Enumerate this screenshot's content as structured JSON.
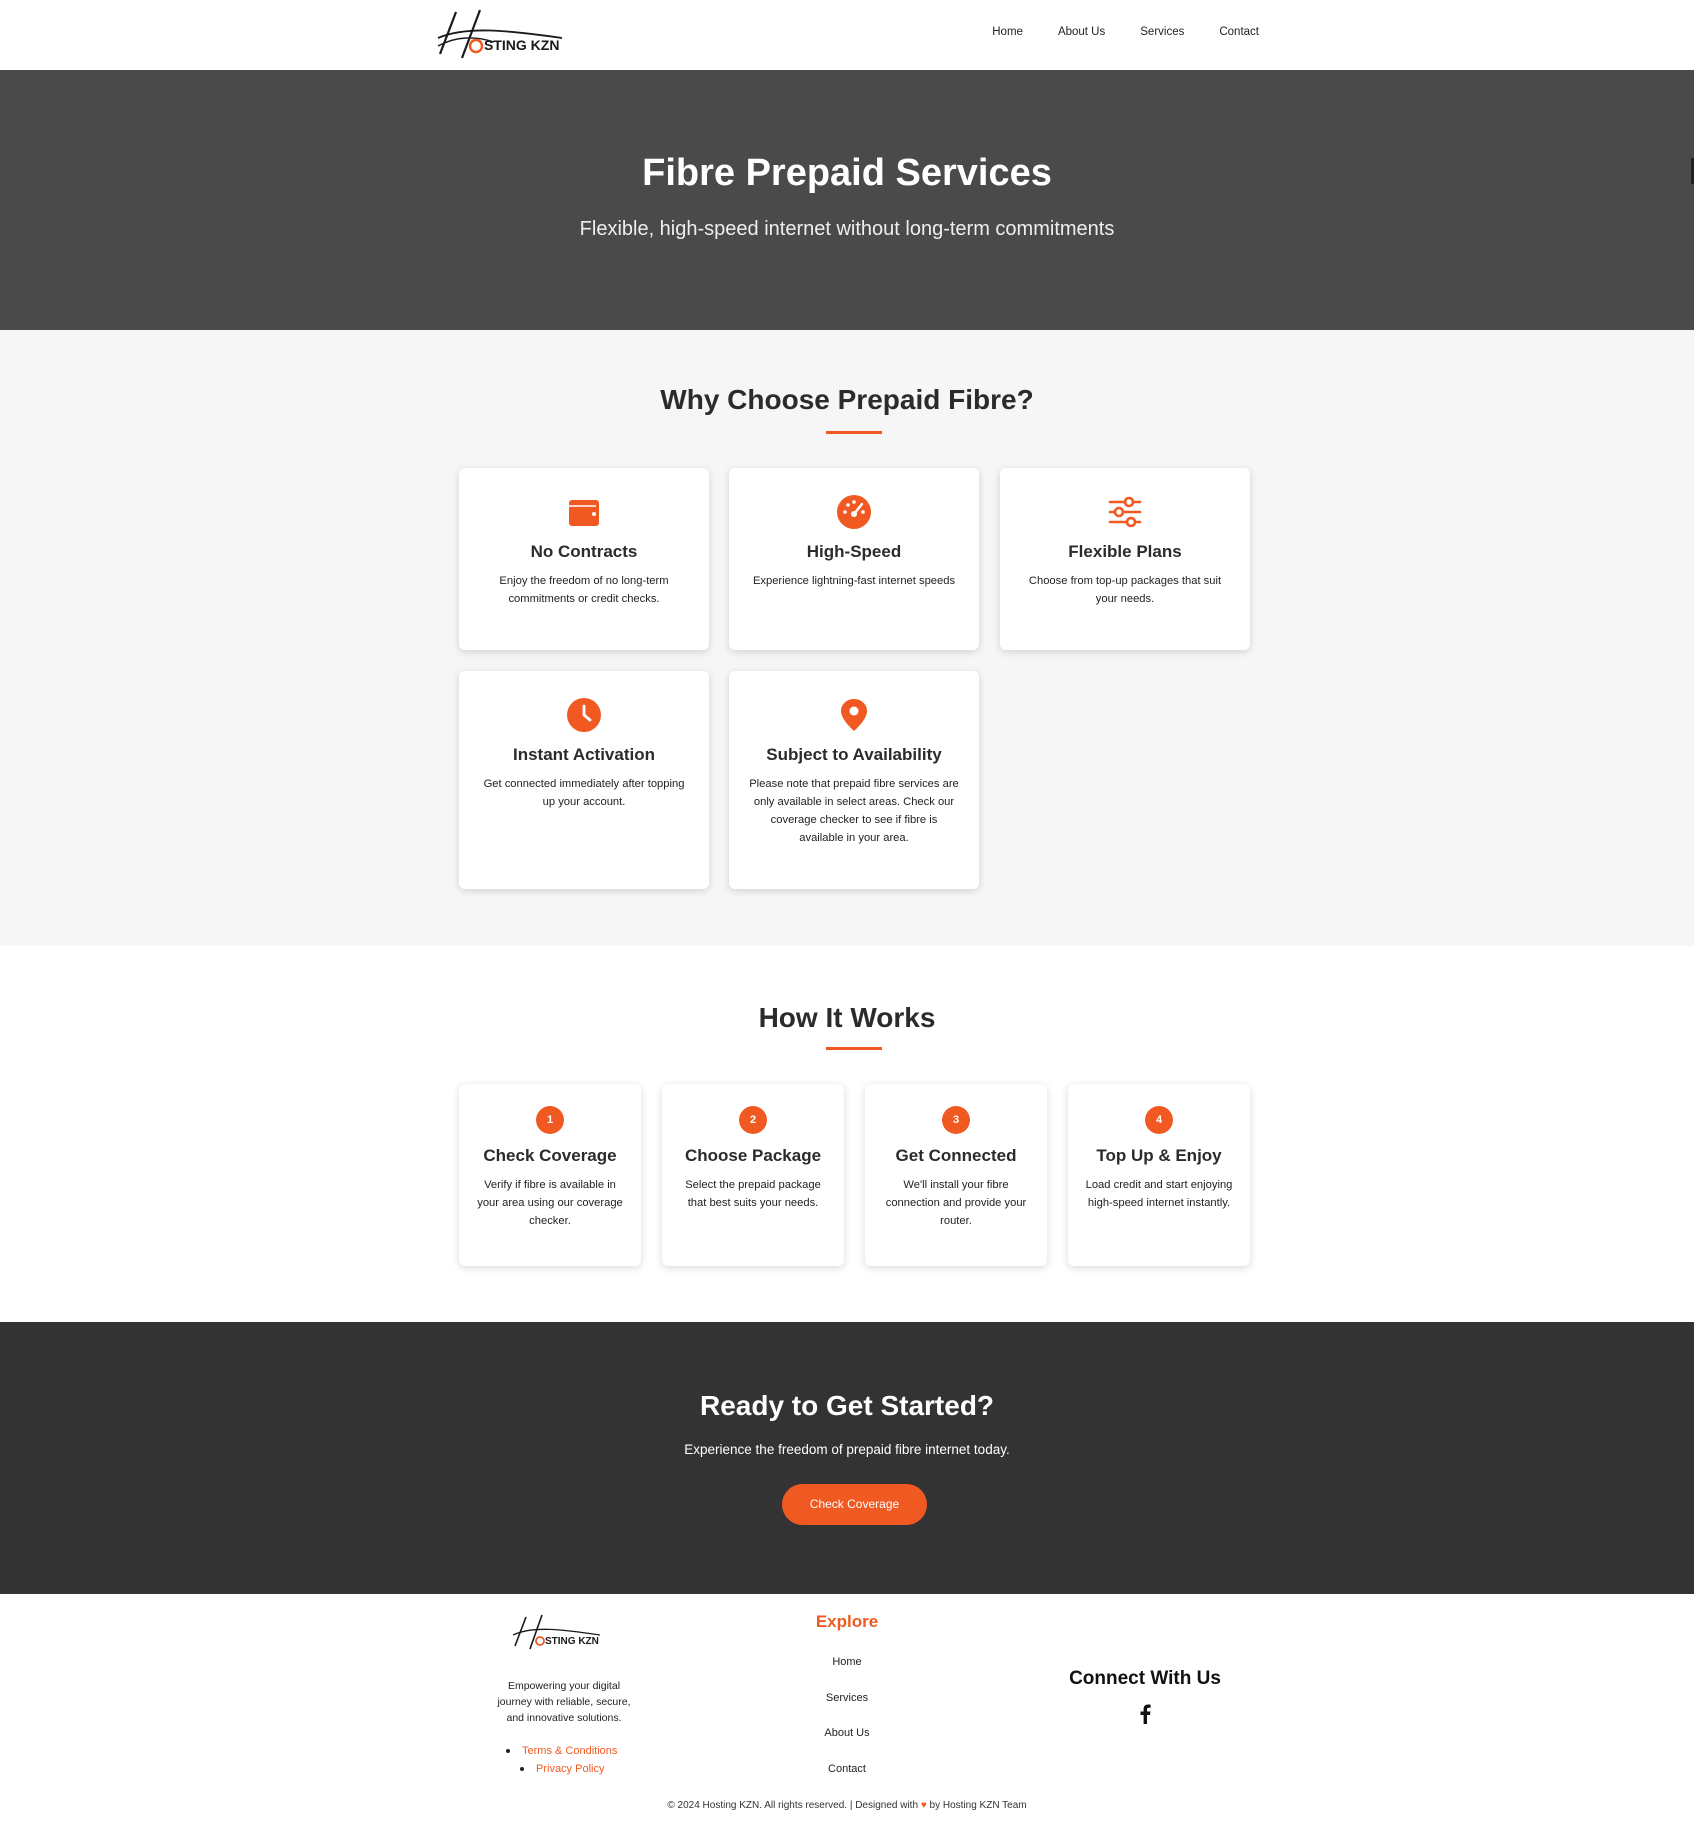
{
  "header": {
    "logo_text": "HOSTING KZN",
    "nav": [
      "Home",
      "About Us",
      "Services",
      "Contact"
    ]
  },
  "hero": {
    "title": "Fibre Prepaid Services",
    "subtitle": "Flexible, high-speed internet without long-term commitments"
  },
  "why": {
    "title": "Why Choose Prepaid Fibre?",
    "cards": [
      {
        "icon": "wallet-icon",
        "title": "No Contracts",
        "text": "Enjoy the freedom of no long-term commitments or credit checks."
      },
      {
        "icon": "speedometer-icon",
        "title": "High-Speed",
        "text": "Experience lightning-fast internet speeds"
      },
      {
        "icon": "sliders-icon",
        "title": "Flexible Plans",
        "text": "Choose from top-up packages that suit your needs."
      },
      {
        "icon": "clock-icon",
        "title": "Instant Activation",
        "text": "Get connected immediately after topping up your account."
      },
      {
        "icon": "map-pin-icon",
        "title": "Subject to Availability",
        "text": "Please note that prepaid fibre services are only available in select areas. Check our coverage checker to see if fibre is available in your area."
      }
    ]
  },
  "how": {
    "title": "How It Works",
    "steps": [
      {
        "num": "1",
        "title": "Check Coverage",
        "text": "Verify if fibre is available in your area using our coverage checker."
      },
      {
        "num": "2",
        "title": "Choose Package",
        "text": "Select the prepaid package that best suits your needs."
      },
      {
        "num": "3",
        "title": "Get Connected",
        "text": "We'll install your fibre connection and provide your router."
      },
      {
        "num": "4",
        "title": "Top Up & Enjoy",
        "text": "Load credit and start enjoying high-speed internet instantly."
      }
    ]
  },
  "cta": {
    "title": "Ready to Get Started?",
    "text": "Experience the freedom of prepaid fibre internet today.",
    "button": "Check Coverage"
  },
  "footer": {
    "tagline": "Empowering your digital journey with reliable, secure, and innovative solutions.",
    "legal": [
      "Terms & Conditions",
      "Privacy Policy"
    ],
    "explore_title": "Explore",
    "explore": [
      "Home",
      "Services",
      "About Us",
      "Contact"
    ],
    "connect_title": "Connect With Us",
    "social": "facebook-icon",
    "copyright_a": "© 2024 Hosting KZN. All rights reserved. | Designed with",
    "copyright_heart": "♥",
    "copyright_b": "by Hosting KZN Team"
  },
  "colors": {
    "accent": "#f05a22",
    "hero_bg": "#4a4a4a",
    "cta_bg": "#333333",
    "section_bg": "#f6f6f6"
  }
}
